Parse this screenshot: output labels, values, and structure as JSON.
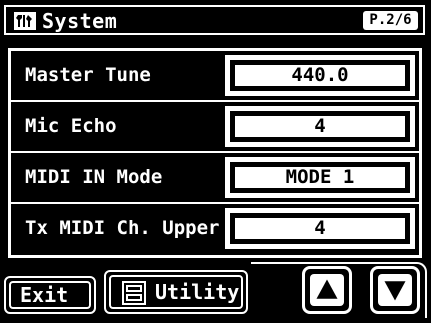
{
  "header": {
    "title": "System",
    "page_indicator": "P.2/6",
    "icon": "tools-icon"
  },
  "parameters": [
    {
      "label": "Master Tune",
      "value": "440.0"
    },
    {
      "label": "Mic Echo",
      "value": "4"
    },
    {
      "label": "MIDI IN Mode",
      "value": "MODE 1"
    },
    {
      "label": "Tx MIDI Ch. Upper",
      "value": "4"
    }
  ],
  "footer": {
    "exit_label": "Exit",
    "utility_label": "Utility",
    "utility_icon": "utility-icon",
    "up_icon": "arrow-up-icon",
    "down_icon": "arrow-down-icon"
  },
  "colors": {
    "background": "#000000",
    "foreground": "#ffffff"
  }
}
